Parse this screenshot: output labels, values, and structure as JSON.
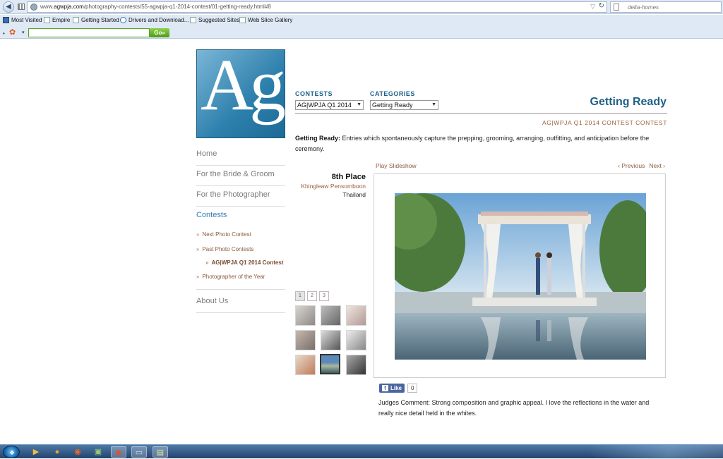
{
  "browser": {
    "url_prefix": "www.",
    "url_domain": "agwpja.com",
    "url_path": "/photography-contests/55-agwpja-q1-2014-contest/01-getting-ready.html#8",
    "search_text": "delta-homes",
    "bookmarks": [
      {
        "label": "Most Visited"
      },
      {
        "label": "Empire"
      },
      {
        "label": "Getting Started"
      },
      {
        "label": "Drivers and Download..."
      },
      {
        "label": "Suggested Sites"
      },
      {
        "label": "Web Slice Gallery"
      }
    ],
    "toolbar_go_label": "Go"
  },
  "sidebar": {
    "items": [
      {
        "label": "Home"
      },
      {
        "label": "For the Bride & Groom"
      },
      {
        "label": "For the Photographer"
      },
      {
        "label": "Contests"
      },
      {
        "label": "About Us"
      }
    ],
    "sub_items": [
      {
        "label": "Next Photo Contest"
      },
      {
        "label": "Past Photo Contests"
      },
      {
        "label": "AG|WPJA Q1 2014 Contest"
      },
      {
        "label": "Photographer of the Year"
      }
    ]
  },
  "logo_text": "Ag",
  "filters": {
    "contests_label": "CONTESTS",
    "contests_value": "AG|WPJA Q1 2014",
    "categories_label": "CATEGORIES",
    "categories_value": "Getting Ready"
  },
  "content": {
    "title": "Getting Ready",
    "subtitle": "AG|WPJA Q1 2014 CONTEST CONTEST",
    "description_bold": "Getting Ready:",
    "description_text": " Entries which spontaneously capture the prepping, grooming, arranging, outfitting, and anticipation before the ceremony.",
    "place": "8th Place",
    "photographer": "Khingleaw Pensomboon",
    "country": "Thailand",
    "play_slideshow": "Play Slideshow",
    "previous": "‹ Previous",
    "next": "Next ›",
    "pages": [
      "1",
      "2",
      "3"
    ],
    "like_label": "Like",
    "like_count": "0",
    "comment": "Judges Comment: Strong composition and graphic appeal. I love the reflections in the water and really nice detail held in the whites."
  }
}
